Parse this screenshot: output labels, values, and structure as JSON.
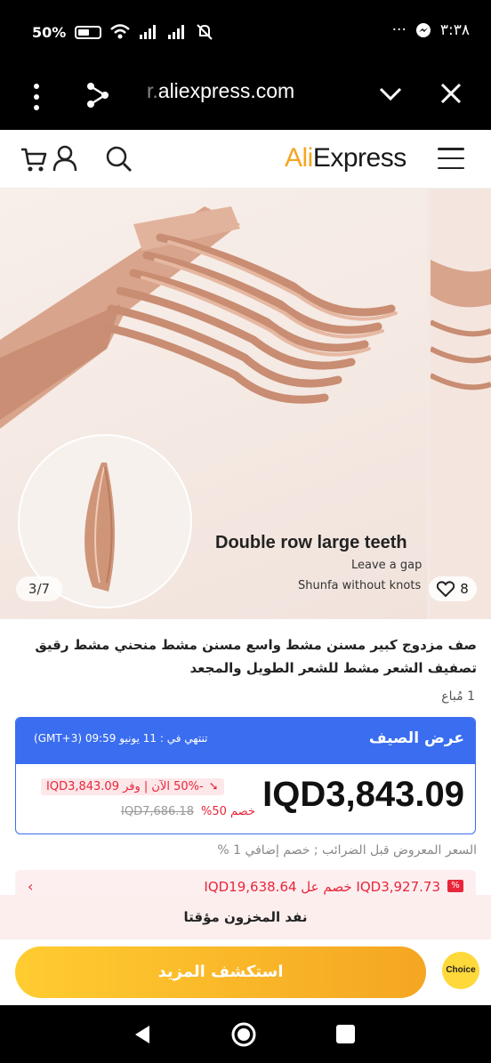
{
  "status_bar": {
    "battery": "50%",
    "time": "٣:٣٨",
    "more": "···"
  },
  "browser": {
    "url_fade": "r.",
    "url": "aliexpress.com"
  },
  "header": {
    "logo_prefix": "Ali",
    "logo_suffix": "Express"
  },
  "gallery": {
    "counter": "3/7",
    "likes": "8",
    "caption_title": "Double row large teeth",
    "caption_line1": "Leave a gap",
    "caption_line2": "Shunfa without knots"
  },
  "product": {
    "title": "صف مزدوج كبير مسنن مشط واسع مسنن مشط منحني مشط رقيق تصفيف الشعر مشط للشعر الطويل والمجعد",
    "sold": "1 مُباع"
  },
  "deal": {
    "name": "عرض الصيف",
    "ends": "تنتهي في : 11 يونيو 09:59 (GMT+3)",
    "price": "IQD3,843.09",
    "save_text": "-50% الآن | وفر IQD3,843.09",
    "discount": "خصم 50%",
    "original_price": "IQD7,686.18"
  },
  "tax_note": "السعر المعروض قبل الضرائب ; خصم إضافي 1 %",
  "coupon": {
    "tag": "%",
    "text": "IQD3,927.73 خصم عل IQD19,638.64",
    "chevron": "‹"
  },
  "out_of_stock": "نفد المخزون مؤقتا",
  "bottom": {
    "explore": "استكشف المزيد",
    "choice": "Choice"
  },
  "colors": {
    "brand_orange": "#f5a623",
    "deal_blue": "#3a6df0",
    "sale_red": "#e8263a"
  }
}
